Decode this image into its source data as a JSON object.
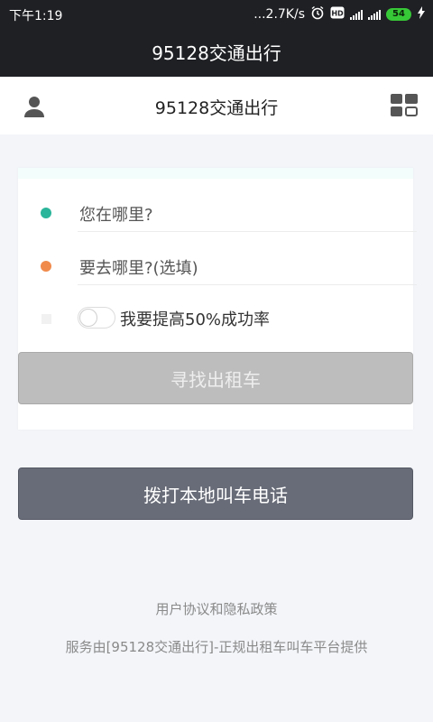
{
  "status_bar": {
    "time": "下午1:19",
    "net_speed": "...2.7K/s",
    "battery_level": "54",
    "icons": [
      "alarm-icon",
      "hd-icon",
      "signal-4g-icon",
      "signal-icon",
      "battery-icon",
      "charging-icon"
    ]
  },
  "app_bar": {
    "title": "95128交通出行"
  },
  "header": {
    "title": "95128交通出行",
    "left_icon": "user-icon",
    "right_icon": "grid-menu-icon"
  },
  "form": {
    "origin_placeholder": "您在哪里?",
    "destination_placeholder": "要去哪里?(选填)",
    "boost_label": "我要提高50%成功率",
    "boost_enabled": false,
    "origin_dot_color": "#2bb59a",
    "destination_dot_color": "#f08a4b",
    "find_button": "寻找出租车"
  },
  "call_button": "拨打本地叫车电话",
  "footer": {
    "policy_link": "用户协议和隐私政策",
    "provider_text": "服务由[95128交通出行]-正规出租车叫车平台提供"
  }
}
